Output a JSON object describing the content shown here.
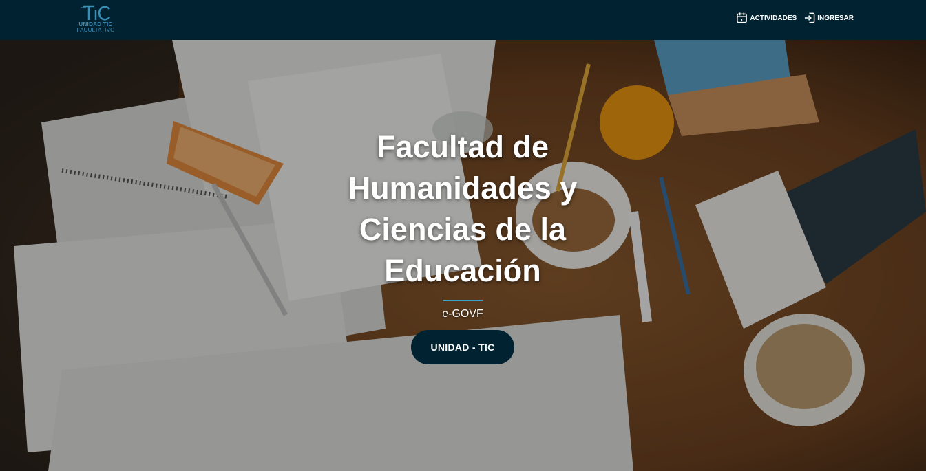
{
  "header": {
    "logo": {
      "mark_text": "TIC",
      "line1": "UNIDAD TIC",
      "line2": "FACULTATIVO"
    },
    "nav": [
      {
        "label": "ACTIVIDADES",
        "icon": "calendar-icon"
      },
      {
        "label": "INGRESAR",
        "icon": "login-icon"
      }
    ]
  },
  "hero": {
    "title_lines": [
      "Facultad de",
      "Humanidades y",
      "Ciencias de la",
      "Educación"
    ],
    "subtitle": "e-GOVF",
    "button_label": "UNIDAD - TIC",
    "accent_color": "#3fa3c9"
  },
  "colors": {
    "navbar_bg": "#002231",
    "button_bg": "#002231",
    "logo_color": "#3a8fb8"
  }
}
